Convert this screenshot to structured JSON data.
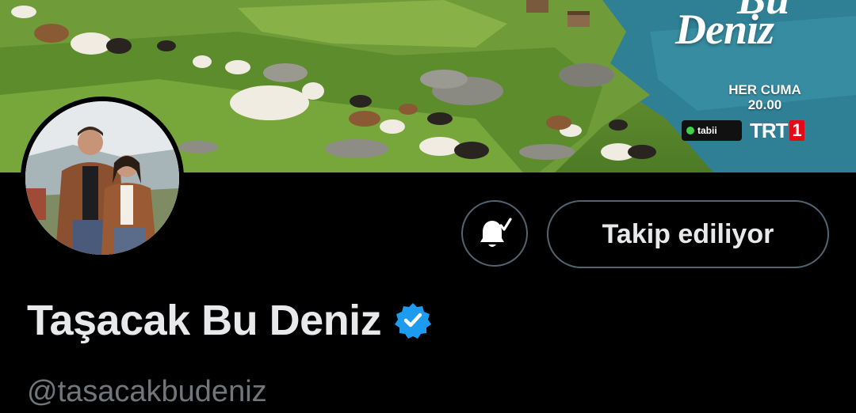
{
  "banner": {
    "show_title_top": "Bu",
    "show_title": "Deniz",
    "airtime_day": "HER CUMA",
    "airtime_time": "20.00",
    "platform_label": "tabii",
    "channel_label": "TRT",
    "channel_number": "1"
  },
  "actions": {
    "notifications_icon": "bell-check-icon",
    "follow_label": "Takip ediliyor"
  },
  "profile": {
    "display_name": "Taşacak Bu Deniz",
    "verified_color": "#1d9bf0",
    "handle": "@tasacakbudeniz"
  },
  "theme": {
    "background": "#000000",
    "text": "#e7e9ea",
    "muted": "#71767b",
    "border": "#536471"
  }
}
